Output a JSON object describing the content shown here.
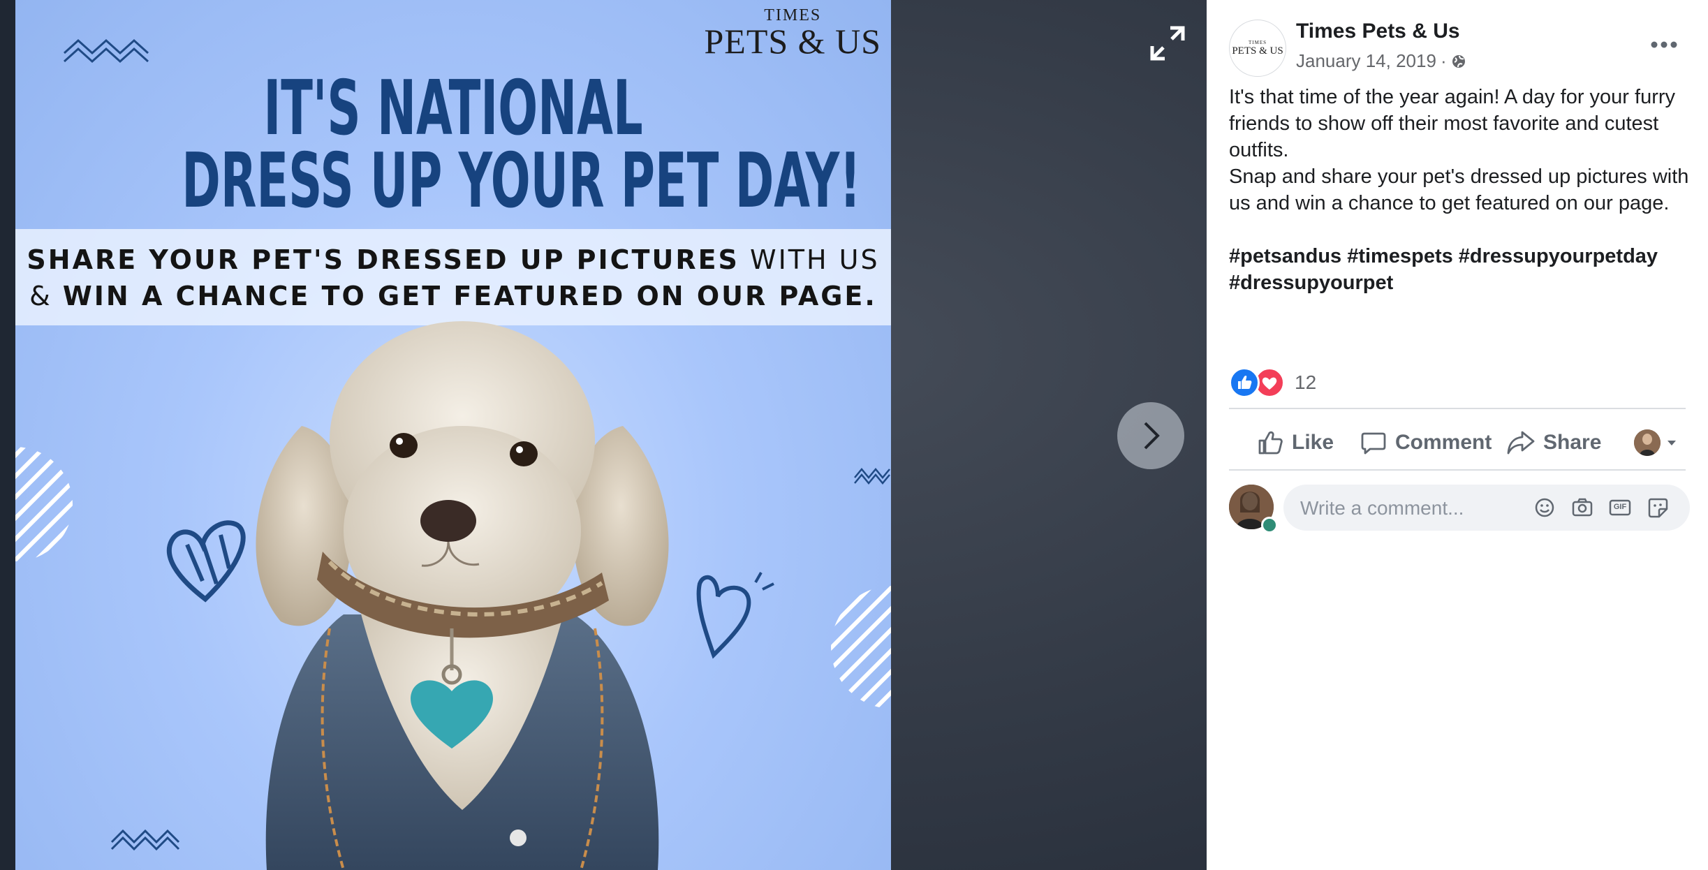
{
  "photo": {
    "brand_small": "TIMES",
    "brand_big": "PETS & US",
    "headline_line1": "IT'S NATIONAL",
    "headline_line2": "DRESS UP YOUR PET DAY!",
    "band_line1_bold": "SHARE YOUR PET'S DRESSED UP PICTURES",
    "band_line1_rest": " WITH US",
    "band_line2_pre": "& ",
    "band_line2_bold": "WIN A CHANCE",
    "band_line2_rest": " TO GET FEATURED ON OUR PAGE.",
    "colors": {
      "background": "#a9c6fb",
      "headline": "#17437f",
      "band": "#ebf3ff"
    }
  },
  "viewer": {
    "enlarge_icon": "expand-icon",
    "next_icon": "chevron-right-icon"
  },
  "post": {
    "avatar_small": "TIMES",
    "avatar_big": "PETS & US",
    "page_name": "Times Pets & Us",
    "date": "January 14, 2019",
    "date_separator": "·",
    "audience_icon": "globe-icon",
    "more_icon": "ellipsis-icon",
    "text_lines": [
      "It's that time of the year again! A day for your furry friends to show off their most favorite and cutest outfits.",
      "Snap and share your pet's dressed up pictures with us and win a chance to get featured on our page."
    ],
    "hashtags": "#petsandus #timespets #dressupyourpetday #dressupyourpet"
  },
  "reactions": {
    "types": [
      "like",
      "love"
    ],
    "count": "12",
    "colors": {
      "like": "#1877f2",
      "love": "#f33e58"
    }
  },
  "actions": {
    "like": "Like",
    "comment": "Comment",
    "share": "Share"
  },
  "comment": {
    "placeholder": "Write a comment...",
    "icons": [
      "emoji-icon",
      "camera-icon",
      "gif-icon",
      "sticker-icon"
    ],
    "gif_label": "GIF"
  }
}
